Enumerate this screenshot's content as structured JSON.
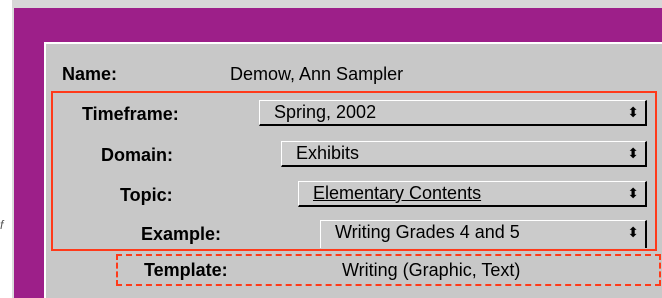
{
  "side_glyph": "f",
  "name": {
    "label": "Name:",
    "value": "Demow, Ann Sampler"
  },
  "timeframe": {
    "label": "Timeframe:",
    "value": "Spring, 2002",
    "arrows": "⬍"
  },
  "domain": {
    "label": "Domain:",
    "value": "Exhibits",
    "arrows": "⬍"
  },
  "topic": {
    "label": "Topic:",
    "value": "Elementary Contents",
    "arrows": "⬍"
  },
  "example": {
    "label": "Example:",
    "value": "Writing Grades 4 and 5",
    "arrows": "⬍"
  },
  "template": {
    "label": "Template:",
    "value": "Writing  (Graphic, Text)"
  },
  "colors": {
    "frame": "#9d1f89",
    "panel": "#c8c8c8",
    "highlight_border": "#ff3a1a"
  }
}
